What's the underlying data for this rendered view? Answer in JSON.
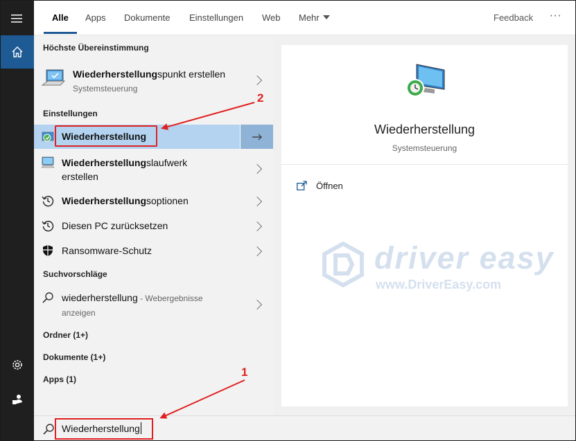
{
  "tabs": [
    {
      "label": "Alle",
      "active": true
    },
    {
      "label": "Apps"
    },
    {
      "label": "Dokumente"
    },
    {
      "label": "Einstellungen"
    },
    {
      "label": "Web"
    },
    {
      "label": "Mehr"
    }
  ],
  "header": {
    "feedback": "Feedback",
    "more": "···"
  },
  "sections": {
    "best": "Höchste Übereinstimmung",
    "settings": "Einstellungen",
    "suggestions": "Suchvorschläge",
    "folders": "Ordner (1+)",
    "documents": "Dokumente (1+)",
    "apps": "Apps (1)"
  },
  "best_match": {
    "bold": "Wiederherstellung",
    "rest": "spunkt erstellen",
    "sub": "Systemsteuerung"
  },
  "settings_items": [
    {
      "bold": "Wiederherstellung",
      "rest": ""
    },
    {
      "bold": "Wiederherstellung",
      "rest": "slaufwerk",
      "line2": "erstellen"
    },
    {
      "bold": "Wiederherstellung",
      "rest": "soptionen"
    },
    {
      "bold": "",
      "rest": "Diesen PC zurücksetzen"
    },
    {
      "bold": "",
      "rest": "Ransomware-Schutz"
    }
  ],
  "suggestion": {
    "text": "wiederherstellung",
    "tag": " - Webergebnisse",
    "line2": "anzeigen"
  },
  "preview": {
    "title": "Wiederherstellung",
    "sub": "Systemsteuerung",
    "open": "Öffnen"
  },
  "watermark": {
    "name": "driver easy",
    "url": "www.DriverEasy.com"
  },
  "search": {
    "value": "Wiederherstellung"
  },
  "annotations": {
    "one": "1",
    "two": "2"
  },
  "colors": {
    "accent": "#1e5a94",
    "highlight": "#b3d3f0",
    "annotation": "#e02020"
  }
}
